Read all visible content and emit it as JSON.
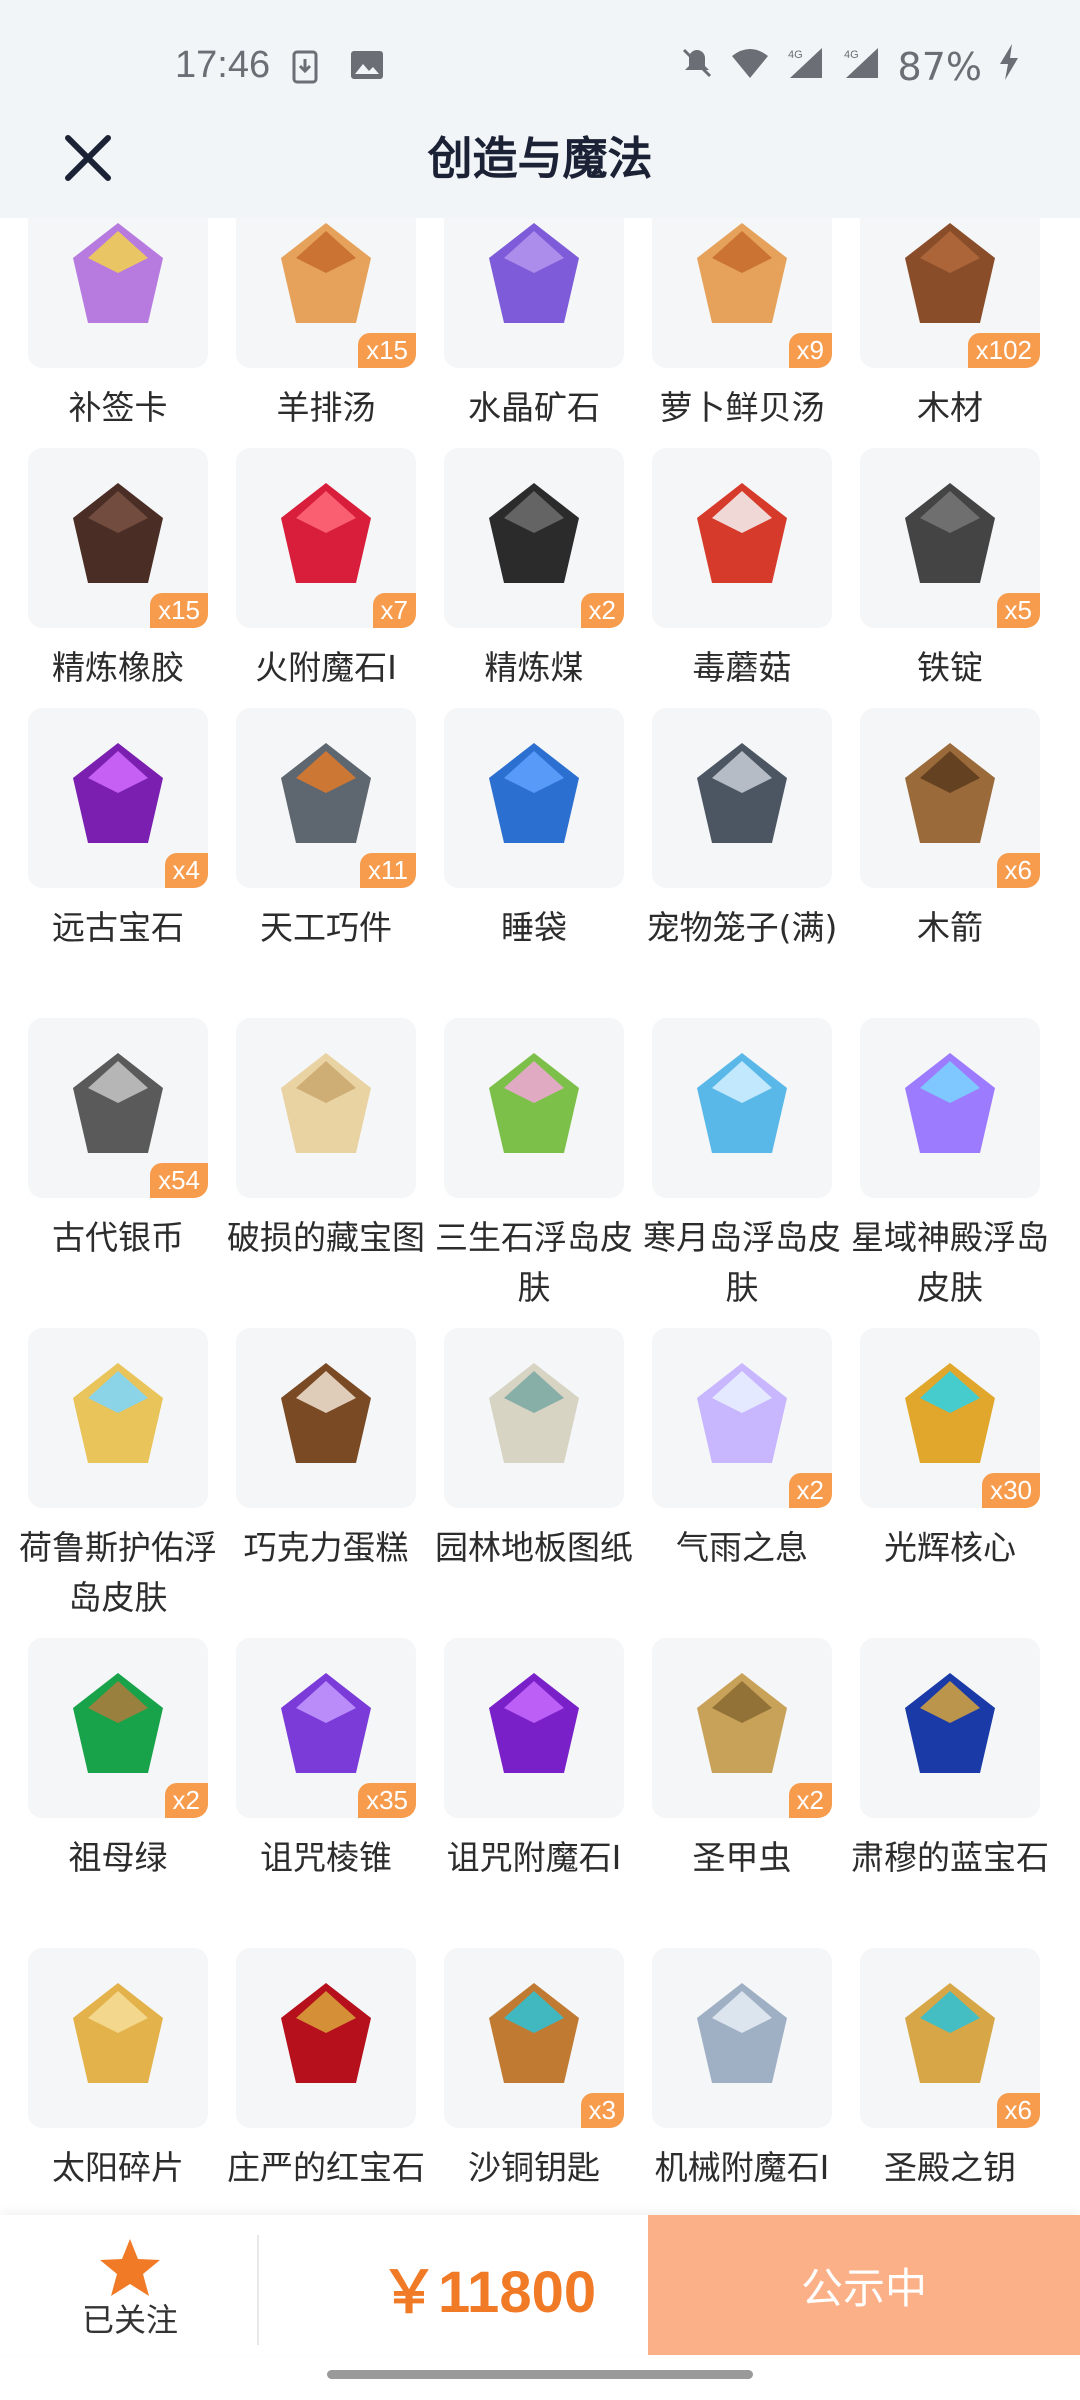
{
  "status_bar": {
    "time": "17:46",
    "battery": "87%",
    "network": "4G"
  },
  "header": {
    "title": "创造与魔法"
  },
  "items": [
    {
      "name": "补签卡",
      "qty": "",
      "icon": "sign-card-icon"
    },
    {
      "name": "羊排汤",
      "qty": "x15",
      "icon": "lamb-soup-icon"
    },
    {
      "name": "水晶矿石",
      "qty": "",
      "icon": "crystal-ore-icon"
    },
    {
      "name": "萝卜鲜贝汤",
      "qty": "x9",
      "icon": "carrot-soup-icon"
    },
    {
      "name": "木材",
      "qty": "x102",
      "icon": "wood-log-icon"
    },
    {
      "name": "精炼橡胶",
      "qty": "x15",
      "icon": "rubber-icon"
    },
    {
      "name": "火附魔石I",
      "qty": "x7",
      "icon": "fire-enchant-stone-icon"
    },
    {
      "name": "精炼煤",
      "qty": "x2",
      "icon": "coal-icon"
    },
    {
      "name": "毒蘑菇",
      "qty": "",
      "icon": "poison-mushroom-icon"
    },
    {
      "name": "铁锭",
      "qty": "x5",
      "icon": "iron-ingot-icon"
    },
    {
      "name": "远古宝石",
      "qty": "x4",
      "icon": "ancient-gem-icon"
    },
    {
      "name": "天工巧件",
      "qty": "x11",
      "icon": "craft-part-icon"
    },
    {
      "name": "睡袋",
      "qty": "",
      "icon": "sleeping-bag-icon"
    },
    {
      "name": "宠物笼子(满)",
      "qty": "",
      "icon": "pet-cage-icon"
    },
    {
      "name": "木箭",
      "qty": "x6",
      "icon": "wooden-arrow-icon"
    },
    {
      "name": "古代银币",
      "qty": "x54",
      "icon": "silver-coin-icon"
    },
    {
      "name": "破损的藏宝图",
      "qty": "",
      "icon": "treasure-map-icon"
    },
    {
      "name": "三生石浮岛皮肤",
      "qty": "",
      "icon": "floating-island-icon"
    },
    {
      "name": "寒月岛浮岛皮肤",
      "qty": "",
      "icon": "ice-island-icon"
    },
    {
      "name": "星域神殿浮岛皮肤",
      "qty": "",
      "icon": "star-temple-icon"
    },
    {
      "name": "荷鲁斯护佑浮岛皮肤",
      "qty": "",
      "icon": "horus-island-icon"
    },
    {
      "name": "巧克力蛋糕",
      "qty": "",
      "icon": "chocolate-cake-icon"
    },
    {
      "name": "园林地板图纸",
      "qty": "",
      "icon": "blueprint-icon"
    },
    {
      "name": "气雨之息",
      "qty": "x2",
      "icon": "mist-orb-icon"
    },
    {
      "name": "光辉核心",
      "qty": "x30",
      "icon": "radiant-core-icon"
    },
    {
      "name": "祖母绿",
      "qty": "x2",
      "icon": "emerald-icon"
    },
    {
      "name": "诅咒棱锥",
      "qty": "x35",
      "icon": "cursed-pyramid-icon"
    },
    {
      "name": "诅咒附魔石I",
      "qty": "",
      "icon": "curse-enchant-stone-icon"
    },
    {
      "name": "圣甲虫",
      "qty": "x2",
      "icon": "scarab-icon"
    },
    {
      "name": "肃穆的蓝宝石",
      "qty": "",
      "icon": "sapphire-icon"
    },
    {
      "name": "太阳碎片",
      "qty": "",
      "icon": "sun-shard-icon"
    },
    {
      "name": "庄严的红宝石",
      "qty": "",
      "icon": "ruby-icon"
    },
    {
      "name": "沙铜钥匙",
      "qty": "x3",
      "icon": "bronze-key-icon"
    },
    {
      "name": "机械附魔石I",
      "qty": "",
      "icon": "mech-enchant-stone-icon"
    },
    {
      "name": "圣殿之钥",
      "qty": "x6",
      "icon": "temple-key-icon"
    }
  ],
  "bottom_bar": {
    "follow_label": "已关注",
    "price": "￥11800",
    "cta_label": "公示中"
  },
  "colors": {
    "accent": "#f79b4c",
    "price": "#f07a25",
    "cta_bg": "#fbb088",
    "header_bg": "#f2f5f8"
  }
}
